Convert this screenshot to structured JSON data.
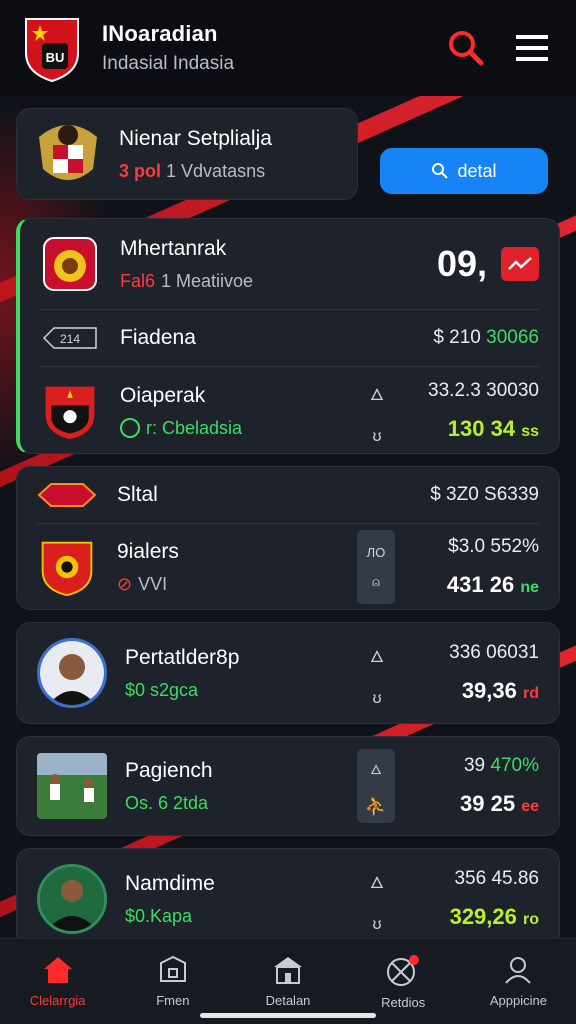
{
  "header": {
    "title": "INoaradian",
    "subtitle": "Indasial Indasia"
  },
  "team_bar": {
    "name": "Nienar Setplialja",
    "sub_red": "3 pol",
    "sub_rest": "1 Vdvatasns"
  },
  "detail_button": {
    "label": "detal"
  },
  "card1": {
    "match": {
      "name": "Mhertanrak",
      "sub_red": "Fal6",
      "sub_rest": "1 Meatiivoe",
      "score": "09,"
    },
    "row1": {
      "badge": "214",
      "name": "Fiadena",
      "value": "$ 210",
      "value_green": "30066"
    },
    "row2": {
      "name": "Oiaperak",
      "sub": "r: Cbeladsia",
      "value": "33.2.3 30030",
      "value2": "130 34",
      "value2_suffix": "ss"
    }
  },
  "card2": {
    "row1": {
      "name": "Sltal",
      "value": "$ 3Z0 S6339"
    },
    "row2": {
      "name": "9ialers",
      "sub": "VVI",
      "box_top": "ЛО",
      "value": "$3.0 552%",
      "value2": "431 26",
      "value2_suffix": "ne"
    }
  },
  "player1": {
    "name": "Pertatlder8p",
    "sub": "$0 s2gca",
    "value": "336 06031",
    "value2": "39,36",
    "value2_suffix": "rd"
  },
  "player2": {
    "name": "Pagiench",
    "sub": "Os. 6 2tda",
    "value": "39",
    "value_green": "470%",
    "value2": "39 25",
    "value2_suffix": "ee"
  },
  "player3": {
    "name": "Namdime",
    "sub": "$0.Kapa",
    "value": "356 45.86",
    "value2": "329,26",
    "value2_suffix": "ro"
  },
  "nav": [
    {
      "label": "Clelarrgia",
      "icon": "home-icon"
    },
    {
      "label": "Fmen",
      "icon": "box-icon"
    },
    {
      "label": "Detalan",
      "icon": "building-icon"
    },
    {
      "label": "Retdios",
      "icon": "ball-icon"
    },
    {
      "label": "Apppicine",
      "icon": "person-icon"
    }
  ],
  "colors": {
    "accent_red": "#ff3b3b",
    "accent_blue": "#1684f5",
    "green": "#3ddc63",
    "lime": "#b8f02a",
    "card": "#1e222b"
  }
}
